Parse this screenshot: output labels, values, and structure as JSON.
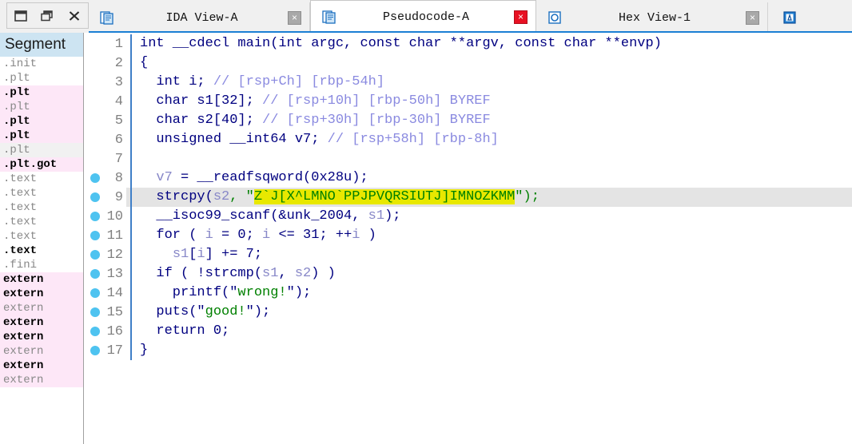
{
  "window_controls": [
    {
      "name": "minimize-restore",
      "icon": "window-icon"
    },
    {
      "name": "restore",
      "icon": "restore-icon"
    },
    {
      "name": "close",
      "icon": "close-icon"
    }
  ],
  "tabs": [
    {
      "label": "IDA View-A",
      "icon": "document-icon",
      "active": false,
      "close": "×"
    },
    {
      "label": "Pseudocode-A",
      "icon": "document-icon",
      "active": true,
      "close": "×"
    },
    {
      "label": "Hex View-1",
      "icon": "hexview-icon",
      "active": false,
      "close": "×"
    },
    {
      "label": "",
      "icon": "structures-icon",
      "active": false,
      "close": ""
    }
  ],
  "sidebar": {
    "header": "Segment",
    "items": [
      {
        "label": ".init",
        "bold": false,
        "bg": "white"
      },
      {
        "label": ".plt",
        "bold": false,
        "bg": "white"
      },
      {
        "label": ".plt",
        "bold": true,
        "bg": "pink"
      },
      {
        "label": ".plt",
        "bold": false,
        "bg": "pink"
      },
      {
        "label": ".plt",
        "bold": true,
        "bg": "pink"
      },
      {
        "label": ".plt",
        "bold": true,
        "bg": "pink"
      },
      {
        "label": ".plt",
        "bold": false,
        "bg": "gray"
      },
      {
        "label": ".plt.got",
        "bold": true,
        "bg": "pink"
      },
      {
        "label": ".text",
        "bold": false,
        "bg": "white"
      },
      {
        "label": ".text",
        "bold": false,
        "bg": "white"
      },
      {
        "label": ".text",
        "bold": false,
        "bg": "white"
      },
      {
        "label": ".text",
        "bold": false,
        "bg": "white"
      },
      {
        "label": ".text",
        "bold": false,
        "bg": "white"
      },
      {
        "label": ".text",
        "bold": true,
        "bg": "white"
      },
      {
        "label": ".fini",
        "bold": false,
        "bg": "white"
      },
      {
        "label": "extern",
        "bold": true,
        "bg": "pink"
      },
      {
        "label": "extern",
        "bold": true,
        "bg": "pink"
      },
      {
        "label": "extern",
        "bold": false,
        "bg": "pink"
      },
      {
        "label": "extern",
        "bold": true,
        "bg": "pink"
      },
      {
        "label": "extern",
        "bold": true,
        "bg": "pink"
      },
      {
        "label": "extern",
        "bold": false,
        "bg": "pink"
      },
      {
        "label": "extern",
        "bold": true,
        "bg": "pink"
      },
      {
        "label": "extern",
        "bold": false,
        "bg": "pink"
      }
    ]
  },
  "code": {
    "highlighted_string": "Z`J[X^LMNO`PPJPVQRSIUTJ]IMNOZKMM",
    "highlighted_line": 9,
    "lines": [
      {
        "n": 1,
        "bp": false,
        "hl": false
      },
      {
        "n": 2,
        "bp": false,
        "hl": false
      },
      {
        "n": 3,
        "bp": false,
        "hl": false
      },
      {
        "n": 4,
        "bp": false,
        "hl": false
      },
      {
        "n": 5,
        "bp": false,
        "hl": false
      },
      {
        "n": 6,
        "bp": false,
        "hl": false
      },
      {
        "n": 7,
        "bp": false,
        "hl": false
      },
      {
        "n": 8,
        "bp": true,
        "hl": false
      },
      {
        "n": 9,
        "bp": true,
        "hl": true
      },
      {
        "n": 10,
        "bp": true,
        "hl": false
      },
      {
        "n": 11,
        "bp": true,
        "hl": false
      },
      {
        "n": 12,
        "bp": true,
        "hl": false
      },
      {
        "n": 13,
        "bp": true,
        "hl": false
      },
      {
        "n": 14,
        "bp": true,
        "hl": false
      },
      {
        "n": 15,
        "bp": true,
        "hl": false
      },
      {
        "n": 16,
        "bp": true,
        "hl": false
      },
      {
        "n": 17,
        "bp": true,
        "hl": false
      }
    ],
    "text": {
      "l1": "int __cdecl main(int argc, const char **argv, const char **envp)",
      "l2": "{",
      "l3_code": "  int i; ",
      "l3_cmt": "// [rsp+Ch] [rbp-54h]",
      "l4_code": "  char s1[32]; ",
      "l4_cmt": "// [rsp+10h] [rbp-50h] BYREF",
      "l5_code": "  char s2[40]; ",
      "l5_cmt": "// [rsp+30h] [rbp-30h] BYREF",
      "l6_code": "  unsigned __int64 v7; ",
      "l6_cmt": "// [rsp+58h] [rbp-8h]",
      "l7": "",
      "l8_a": "  ",
      "l8_v": "v7",
      "l8_b": " = __readfsqword(0x28u);",
      "l9_a": "  strcpy(",
      "l9_v": "s2",
      "l9_b": ", \"",
      "l9_str": "Z`J[X^LMNO`PPJPVQRSIUTJ]IMNOZKMM",
      "l9_c": "\");",
      "l10_a": "  __isoc99_scanf(&unk_2004, ",
      "l10_v": "s1",
      "l10_b": ");",
      "l11_a": "  for ( ",
      "l11_i1": "i",
      "l11_b": " = 0; ",
      "l11_i2": "i",
      "l11_c": " <= 31; ++",
      "l11_i3": "i",
      "l11_d": " )",
      "l12_a": "    ",
      "l12_v": "s1",
      "l12_b": "[",
      "l12_i": "i",
      "l12_c": "] += 7;",
      "l13_a": "  if ( !strcmp(",
      "l13_v1": "s1",
      "l13_b": ", ",
      "l13_v2": "s2",
      "l13_c": ") )",
      "l14_a": "    printf(\"",
      "l14_str": "wrong!",
      "l14_b": "\");",
      "l15_a": "  puts(\"",
      "l15_str": "good!",
      "l15_b": "\");",
      "l16": "  return 0;",
      "l17": "}"
    }
  },
  "colors": {
    "accent_blue": "#1b7fd4",
    "breakpoint_dot": "#4ec3f0",
    "highlight_yellow": "#e8e800",
    "string_green": "#008000",
    "keyword_navy": "#000080",
    "comment_violet": "#8a8ae0",
    "segment_header_bg": "#cde4f2",
    "segment_pink_bg": "#fde7f7"
  }
}
